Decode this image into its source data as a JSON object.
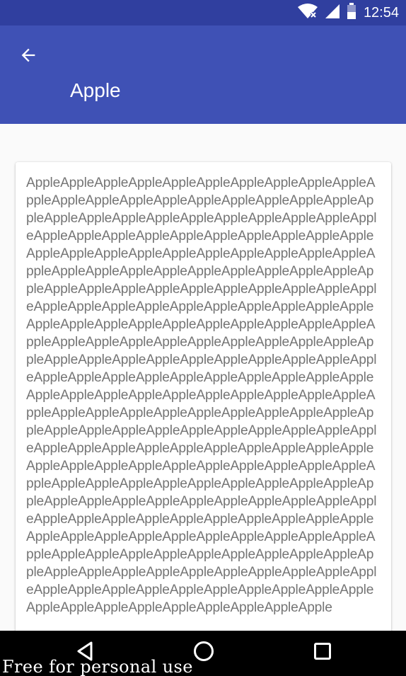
{
  "status_bar": {
    "time": "12:54",
    "icons": [
      "wifi-no-internet-icon",
      "cell-signal-icon",
      "battery-icon"
    ]
  },
  "toolbar": {
    "title": "Apple",
    "back_icon": "arrow-back-icon"
  },
  "card": {
    "body_text": "AppleAppleAppleAppleAppleAppleAppleAppleAppleAppleAppleAppleAppleAppleAppleAppleAppleAppleAppleAppleAppleAppleAppleAppleAppleAppleAppleAppleAppleAppleAppleAppleAppleAppleAppleAppleAppleAppleAppleAppleAppleAppleAppleAppleAppleAppleAppleAppleAppleAppleAppleAppleAppleAppleAppleAppleAppleAppleAppleAppleAppleAppleAppleAppleAppleAppleAppleAppleAppleAppleAppleAppleAppleAppleAppleAppleAppleAppleAppleAppleAppleAppleAppleAppleAppleAppleAppleAppleAppleAppleAppleAppleAppleAppleAppleAppleAppleAppleAppleAppleAppleAppleAppleAppleAppleAppleAppleAppleAppleAppleAppleAppleAppleAppleAppleAppleAppleAppleAppleAppleAppleAppleAppleAppleAppleAppleAppleAppleAppleAppleAppleAppleAppleAppleAppleAppleAppleAppleAppleAppleAppleAppleAppleAppleAppleAppleAppleAppleAppleAppleAppleAppleAppleAppleAppleAppleAppleAppleAppleAppleAppleAppleAppleAppleAppleAppleAppleAppleAppleAppleAppleAppleAppleAppleAppleAppleAppleAppleAppleAppleAppleAppleAppleAppleAppleAppleAppleAppleAppleAppleAppleAppleAppleAppleAppleAppleAppleAppleAppleAppleAppleAppleAppleAppleAppleAppleAppleAppleAppleAppleAppleAppleAppleAppleAppleAppleAppleAppleAppleAppleAppleAppleAppleAppleAppleAppleAppleAppleAppleAppleAppleAppleAppleAppleAppleAppleAppleAppleAppleAppleAppleAppleAppleAppleAppleAppleAppleAppleAppleAppleAppleAppleAppleAppleApple"
  },
  "nav_bar": {
    "icons": [
      "nav-back-icon",
      "nav-home-icon",
      "nav-recents-icon"
    ]
  },
  "watermark": {
    "text": "Free for personal use"
  },
  "colors": {
    "status_bar": "#303f9f",
    "toolbar": "#3f51b5",
    "background": "#fafafa",
    "card": "#ffffff",
    "body_text": "#757575",
    "nav_bar": "#000000"
  }
}
